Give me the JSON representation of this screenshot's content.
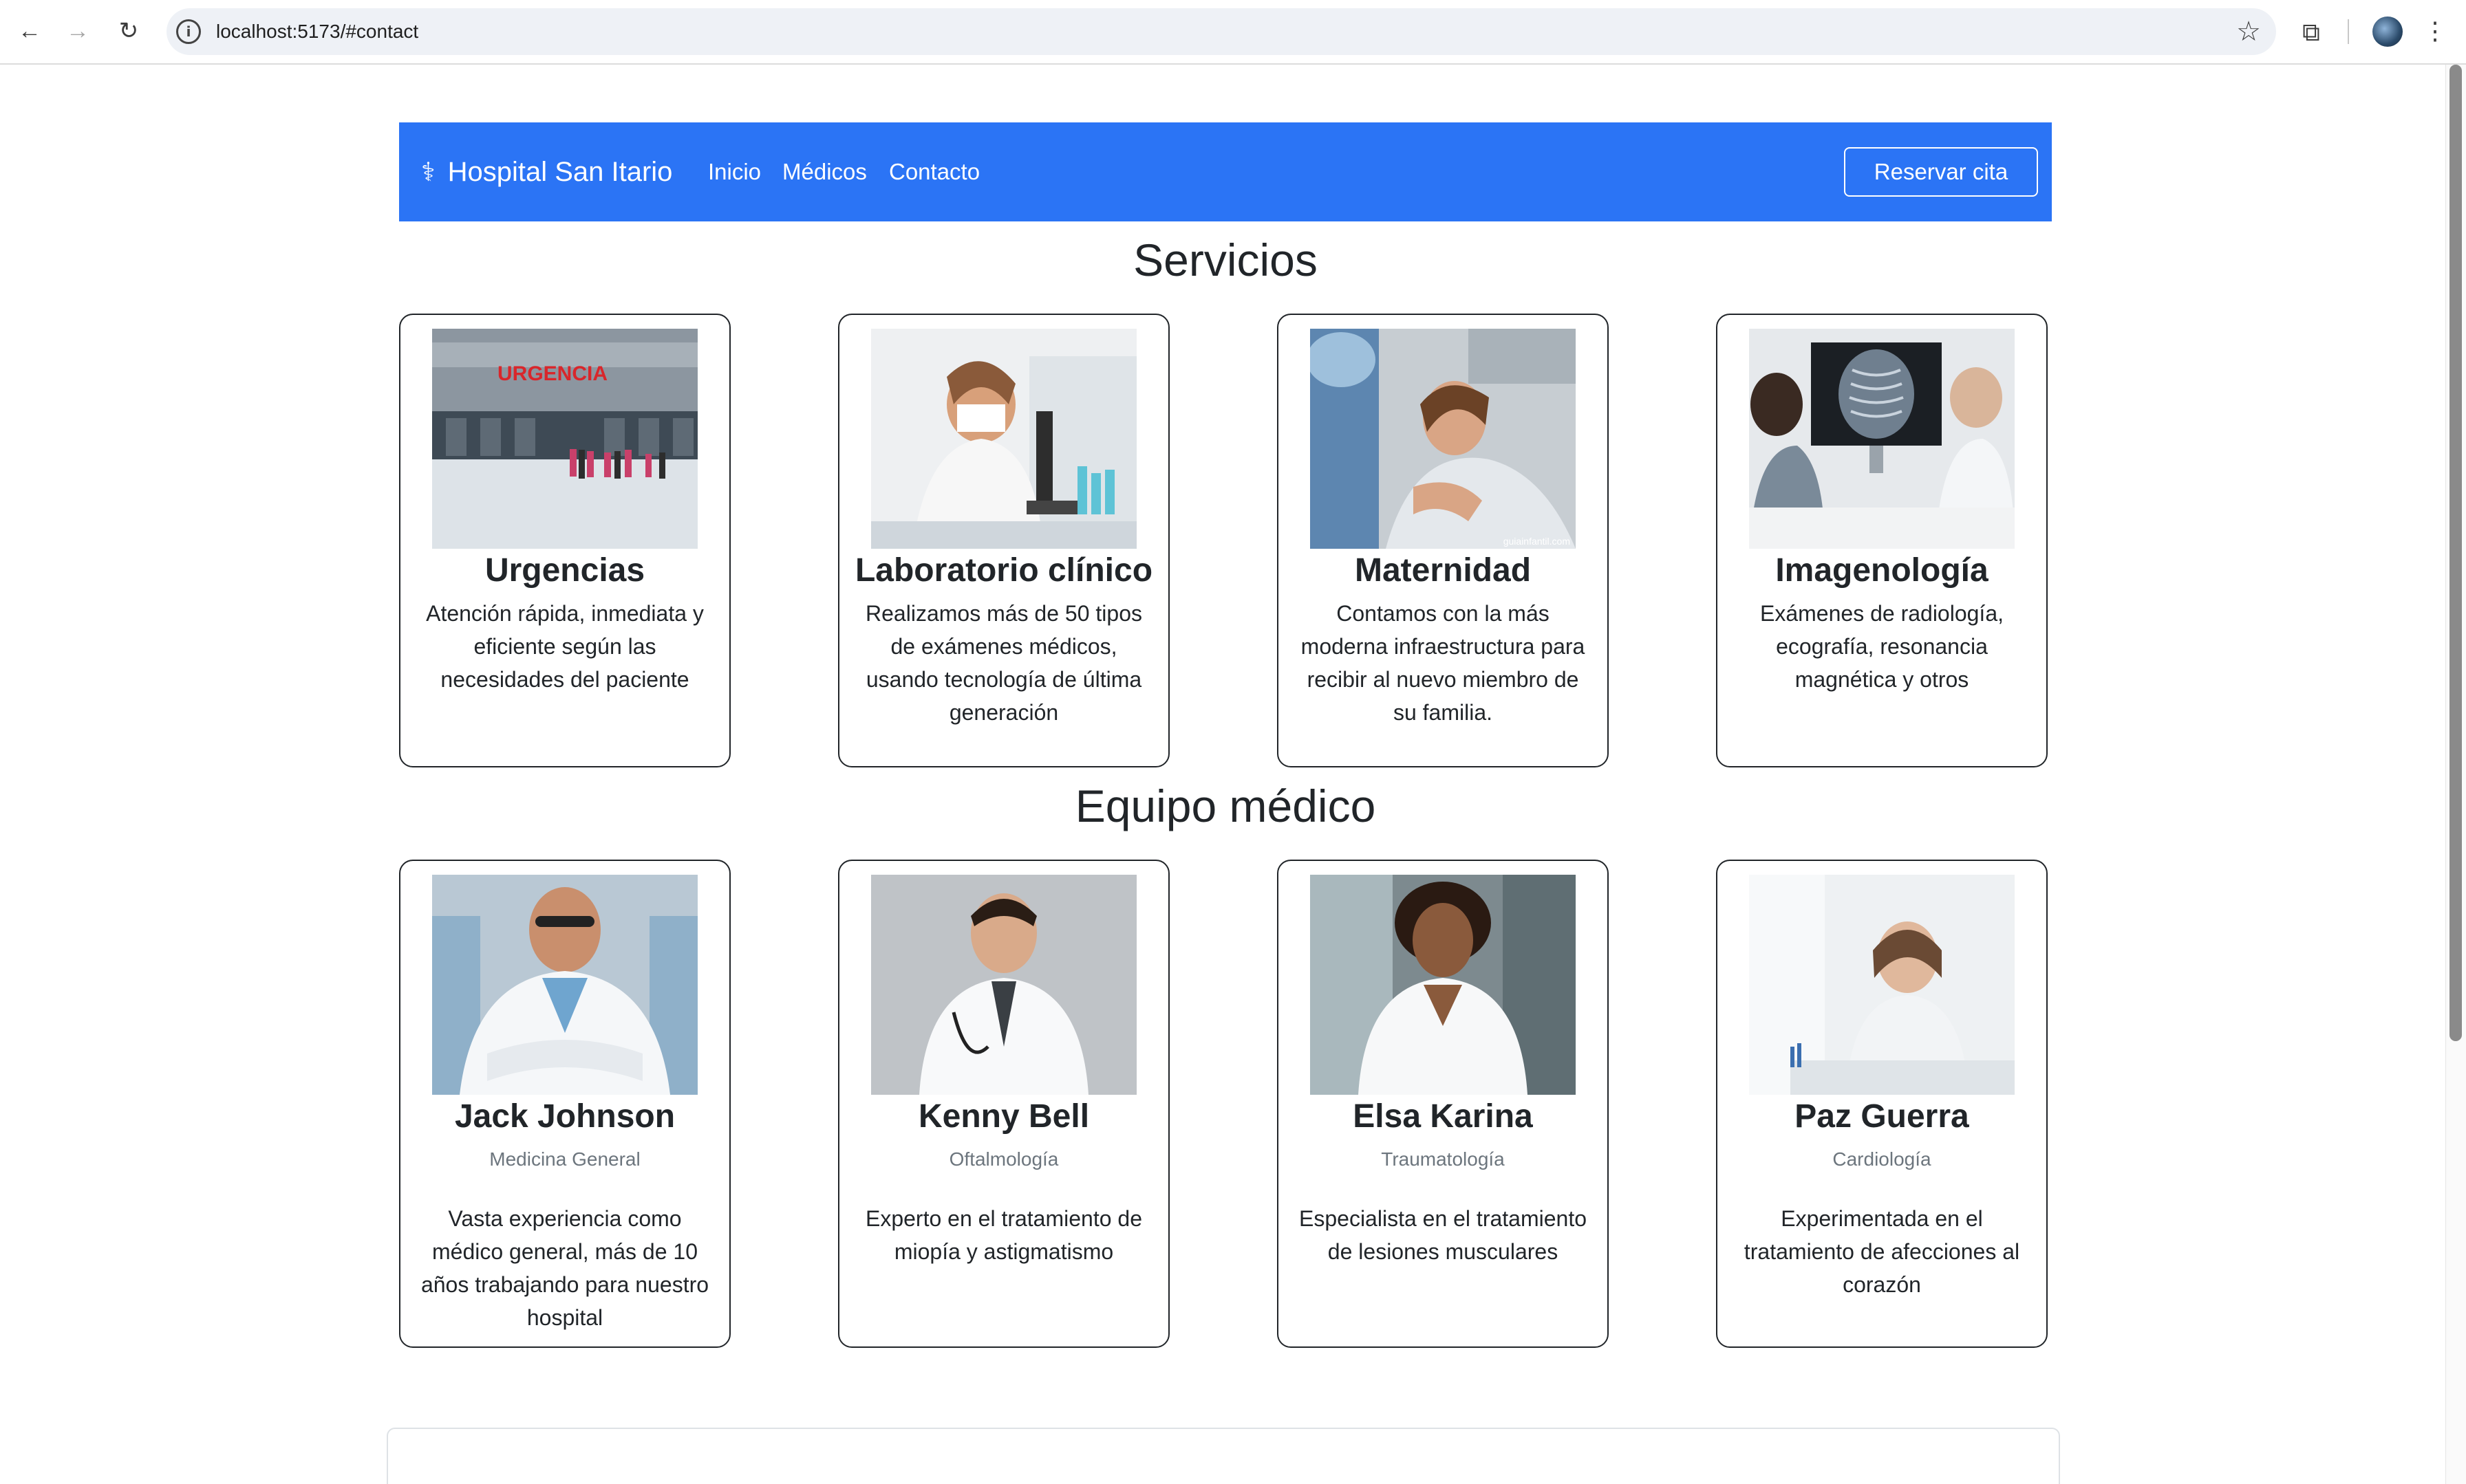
{
  "browser": {
    "url": "localhost:5173/#contact"
  },
  "nav": {
    "brand": "Hospital San Itario",
    "links": [
      "Inicio",
      "Médicos",
      "Contacto"
    ],
    "cta": "Reservar cita"
  },
  "services": {
    "title": "Servicios",
    "items": [
      {
        "title": "Urgencias",
        "text": "Atención rápida, inmediata y eficiente según las necesidades del paciente",
        "photo_label": "URGENCIA"
      },
      {
        "title": "Laboratorio clínico",
        "text": "Realizamos más de 50 tipos de exámenes médicos, usando tecnología de última generación"
      },
      {
        "title": "Maternidad",
        "text": "Contamos con la más moderna infraestructura para recibir al nuevo miembro de su familia.",
        "photo_watermark": "guiainfantil.com"
      },
      {
        "title": "Imagenología",
        "text": "Exámenes de radiología, ecografía, resonancia magnética y otros"
      }
    ]
  },
  "team": {
    "title": "Equipo médico",
    "doctors": [
      {
        "name": "Jack Johnson",
        "specialty": "Medicina General",
        "text": "Vasta experiencia como médico general, más de 10 años trabajando para nuestro hospital"
      },
      {
        "name": "Kenny Bell",
        "specialty": "Oftalmología",
        "text": "Experto en el tratamiento de miopía y astigmatismo"
      },
      {
        "name": "Elsa Karina",
        "specialty": "Traumatología",
        "text": "Especialista en el tratamiento de lesiones musculares"
      },
      {
        "name": "Paz Guerra",
        "specialty": "Cardiología",
        "text": "Experimentada en el tratamiento de afecciones al corazón"
      }
    ]
  },
  "contact_form": {
    "title_partial": ""
  },
  "colors": {
    "primary": "#2b74f5",
    "text": "#212529",
    "muted": "#6c757d"
  },
  "icons": [
    "back-arrow-icon",
    "forward-arrow-icon",
    "reload-icon",
    "site-info-icon",
    "bookmark-star-icon",
    "extensions-icon",
    "profile-avatar-icon",
    "menu-dots-icon",
    "caduceus-icon"
  ]
}
